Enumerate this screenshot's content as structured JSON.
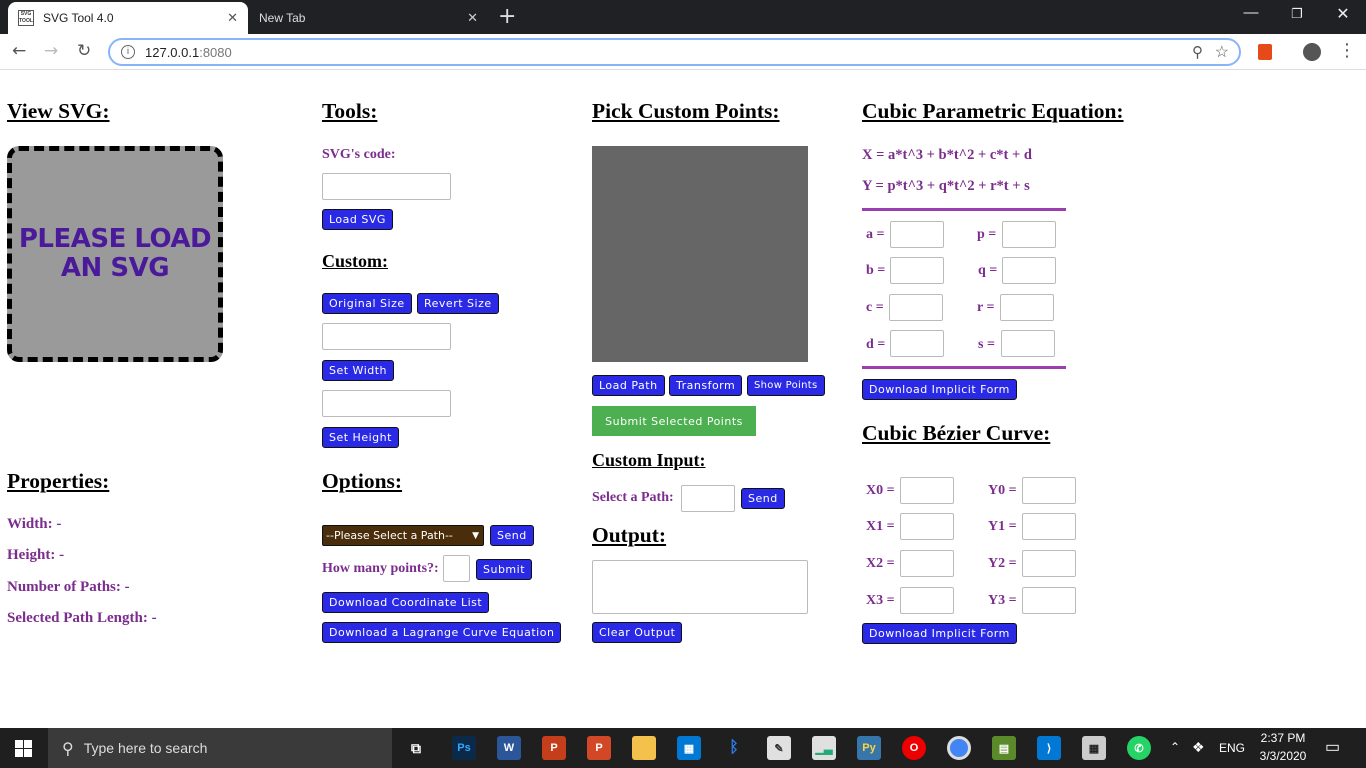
{
  "browser": {
    "tabs": [
      {
        "title": "SVG Tool 4.0"
      },
      {
        "title": "New Tab"
      }
    ],
    "url_host": "127.0.0.1",
    "url_port": ":8080"
  },
  "view": {
    "heading": "View SVG:",
    "placeholder_line1": "PLEASE LOAD",
    "placeholder_line2": "AN SVG"
  },
  "properties": {
    "heading": "Properties:",
    "width": "Width: -",
    "height": "Height: -",
    "paths": "Number of Paths: -",
    "length": "Selected Path Length: -"
  },
  "tools": {
    "heading": "Tools:",
    "code_label": "SVG's code:",
    "load_btn": "Load SVG",
    "custom_heading": "Custom:",
    "original_btn": "Original Size",
    "revert_btn": "Revert Size",
    "set_width_btn": "Set Width",
    "set_height_btn": "Set Height"
  },
  "options": {
    "heading": "Options:",
    "select_value": "--Please Select a Path--",
    "send_btn": "Send",
    "points_label": "How many points?:",
    "submit_btn": "Submit",
    "coord_btn": "Download Coordinate List",
    "lagrange_btn": "Download a Lagrange Curve Equation"
  },
  "pick": {
    "heading": "Pick Custom Points:",
    "load_path_btn": "Load Path",
    "transform_btn": "Transform",
    "show_points_btn": "Show Points",
    "submit_selected_btn": "Submit Selected Points",
    "custom_input_heading": "Custom Input:",
    "select_path_label": "Select a Path:",
    "send_btn": "Send",
    "output_heading": "Output:",
    "clear_btn": "Clear Output"
  },
  "cubic": {
    "heading": "Cubic Parametric Equation:",
    "eq_x": "X = a*t^3 + b*t^2 + c*t + d",
    "eq_y": "Y = p*t^3 + q*t^2 + r*t + s",
    "labels_left": [
      "a =",
      "b =",
      "c =",
      "d ="
    ],
    "labels_right": [
      "p =",
      "q =",
      "r =",
      "s ="
    ],
    "download_btn": "Download Implicit Form"
  },
  "bezier": {
    "heading": "Cubic Bézier Curve:",
    "labels_x": [
      "X0 =",
      "X1 =",
      "X2 =",
      "X3 ="
    ],
    "labels_y": [
      "Y0 =",
      "Y1 =",
      "Y2 =",
      "Y3 ="
    ],
    "download_btn": "Download Implicit Form"
  },
  "taskbar": {
    "search_placeholder": "Type here to search",
    "lang": "ENG",
    "time": "2:37 PM",
    "date": "3/3/2020"
  },
  "colors": {
    "button_blue": "#2929e6",
    "label_purple": "#7b2d8e",
    "submit_green": "#4caf50",
    "select_brown": "#4a2d0a"
  }
}
